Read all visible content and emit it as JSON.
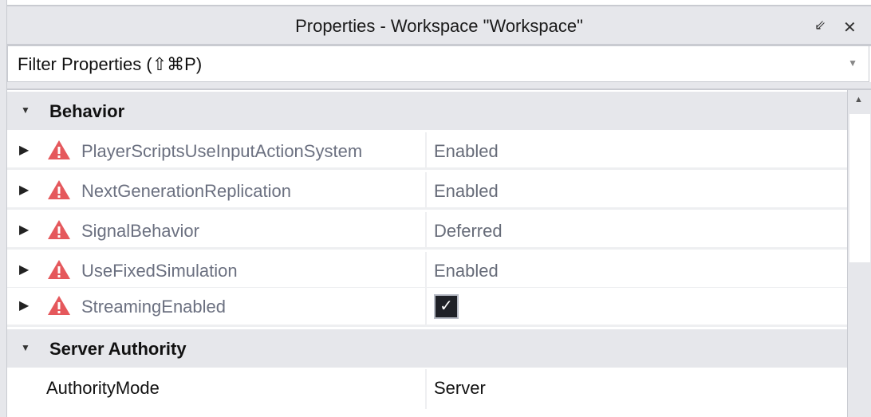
{
  "window": {
    "title": "Properties - Workspace \"Workspace\""
  },
  "filter": {
    "placeholder": "Filter Properties (⇧⌘P)"
  },
  "categories": [
    {
      "label": "Behavior",
      "rows": [
        {
          "name": "PlayerScriptsUseInputActionSystem",
          "value": "Enabled"
        },
        {
          "name": "NextGenerationReplication",
          "value": "Enabled"
        },
        {
          "name": "SignalBehavior",
          "value": "Deferred"
        },
        {
          "name": "UseFixedSimulation",
          "value": "Enabled"
        },
        {
          "name": "StreamingEnabled",
          "checked": true
        }
      ]
    },
    {
      "label": "Server Authority",
      "rows": [
        {
          "name": "AuthorityMode",
          "value": "Server"
        }
      ]
    }
  ],
  "colors": {
    "warning": "#e5585c",
    "header": "#e6e7eb"
  }
}
